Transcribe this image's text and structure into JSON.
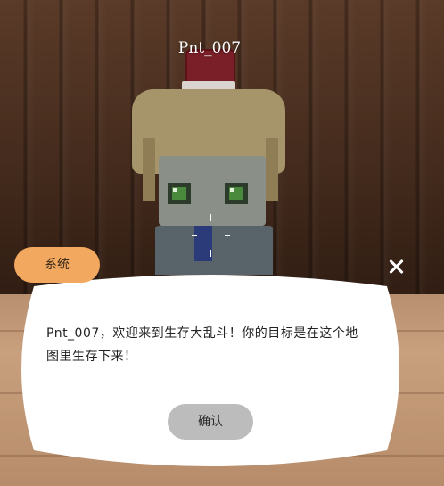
{
  "player": {
    "name": "Pnt_007"
  },
  "dialog": {
    "tag_label": "系统",
    "message": "Pnt_007，欢迎来到生存大乱斗！你的目标是在这个地图里生存下来！",
    "confirm_label": "确认",
    "close_icon": "close-icon"
  },
  "colors": {
    "tag_bg": "#f2a85e",
    "button_bg": "#bcbcbc",
    "dialog_bg": "#ffffff"
  }
}
